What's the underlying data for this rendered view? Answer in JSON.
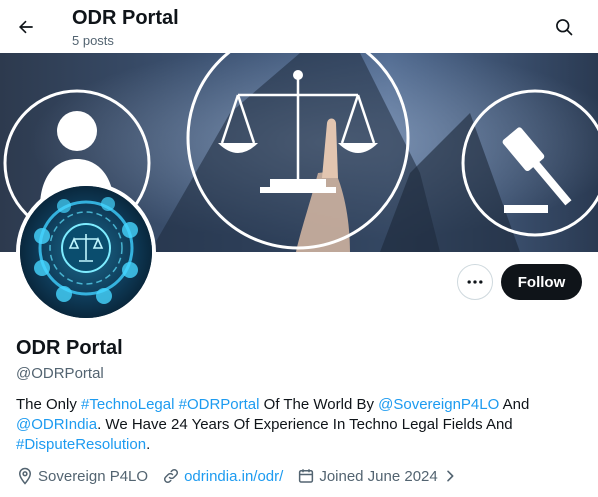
{
  "header": {
    "title": "ODR Portal",
    "post_count": "5 posts"
  },
  "profile": {
    "name": "ODR Portal",
    "handle": "@ODRPortal",
    "follow_label": "Follow"
  },
  "bio": {
    "text_1": "The Only ",
    "tag_techno": "#TechnoLegal",
    "space_1": " ",
    "tag_odr": "#ODRPortal",
    "text_2": " Of The World By ",
    "mention_sovereign": "@SovereignP4LO",
    "text_3": " And",
    "mention_odrindia": "@ODRIndia",
    "text_4": ". We Have 24 Years Of Experience In Techno Legal Fields And",
    "tag_dispute": "#DisputeResolution",
    "text_5": "."
  },
  "meta": {
    "location": "Sovereign P4LO",
    "website": "odrindia.in/odr/",
    "joined": "Joined June 2024"
  },
  "icons": {
    "back": "arrow-left-icon",
    "search": "search-icon",
    "more": "more-icon",
    "location": "location-pin-icon",
    "link": "link-icon",
    "calendar": "calendar-icon",
    "chevron": "chevron-right-icon"
  },
  "colors": {
    "link": "#1d9bf0",
    "follow_bg": "#0f1419",
    "secondary_text": "#536471"
  }
}
